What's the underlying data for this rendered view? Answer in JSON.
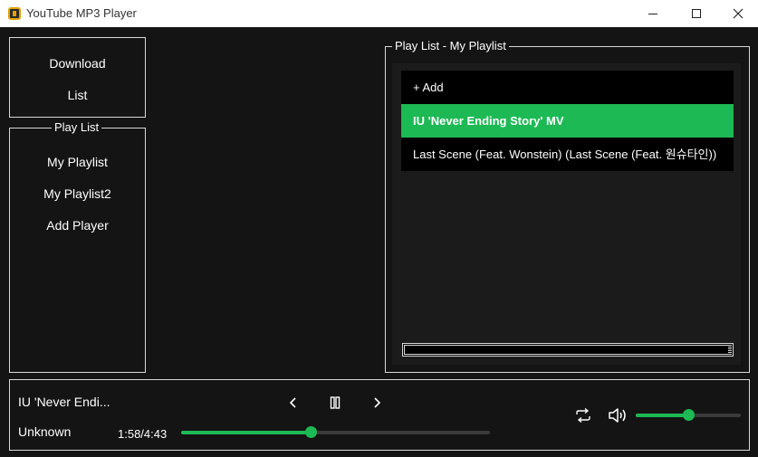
{
  "window": {
    "title": "YouTube MP3 Player"
  },
  "sidebar": {
    "top_items": [
      {
        "label": "Download"
      },
      {
        "label": "List"
      }
    ],
    "playlist_group": {
      "legend": "Play List",
      "items": [
        {
          "label": "My Playlist"
        },
        {
          "label": "My Playlist2"
        },
        {
          "label": "Add Player"
        }
      ]
    }
  },
  "playlist_panel": {
    "legend": "Play List - My Playlist",
    "add_label": "+ Add",
    "tracks": [
      {
        "title": "IU 'Never Ending Story' MV",
        "selected": true
      },
      {
        "title": "Last Scene (Feat. Wonstein) (Last Scene (Feat. 원슈타인))",
        "selected": false
      }
    ]
  },
  "player": {
    "title": "IU 'Never Endi...",
    "artist": "Unknown",
    "time": "1:58/4:43",
    "progress_fraction": 0.42,
    "volume_fraction": 0.5
  },
  "colors": {
    "accent": "#1db954",
    "background": "#141414",
    "border": "#d9d9d9"
  },
  "icons": {
    "prev": "chevron-left-icon",
    "pause": "pause-icon",
    "next": "chevron-right-icon",
    "repeat": "repeat-icon",
    "volume": "volume-icon"
  }
}
